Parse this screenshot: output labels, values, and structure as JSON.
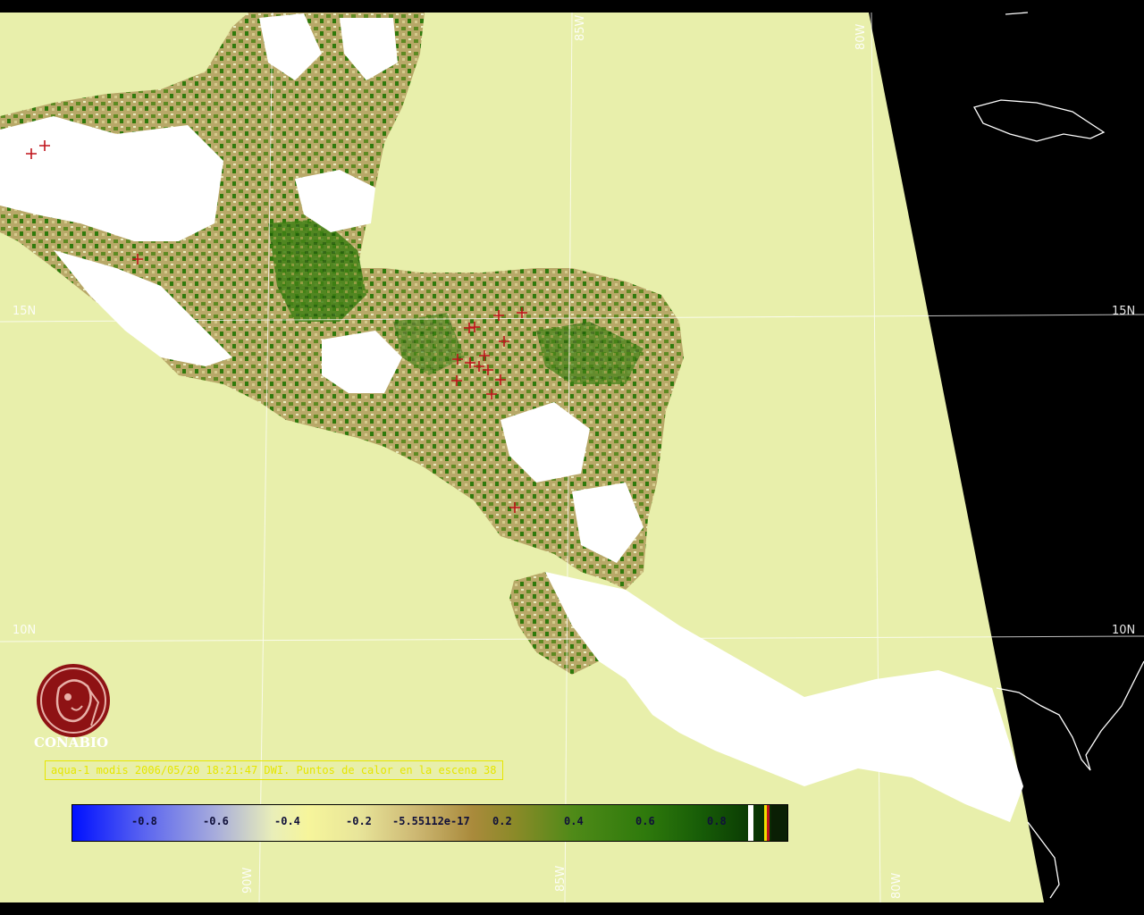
{
  "map": {
    "lat_labels": [
      "15N",
      "15N",
      "10N",
      "10N"
    ],
    "lon_labels": [
      "90W",
      "85W",
      "85W",
      "80W",
      "80W"
    ]
  },
  "logo": {
    "text": "CONABIO"
  },
  "caption": "aqua-1 modis 2006/05/20 18:21:47 DWI. Puntos de calor en la escena 38",
  "colorbar": {
    "labels": [
      "-0.8",
      "-0.6",
      "-0.4",
      "-0.2",
      "-5.55112e-17",
      "0.2",
      "0.4",
      "0.6",
      "0.8"
    ]
  },
  "colors": {
    "ocean": "#e8efab",
    "space": "#000000",
    "cloud": "#ffffff",
    "veg_high": "#2f7a0c",
    "veg_mid": "#a89a55",
    "hotspot": "#c0141c",
    "caption": "#e6e600"
  },
  "icons": [
    "hotspot-cross-icon",
    "conabio-logo-icon"
  ]
}
